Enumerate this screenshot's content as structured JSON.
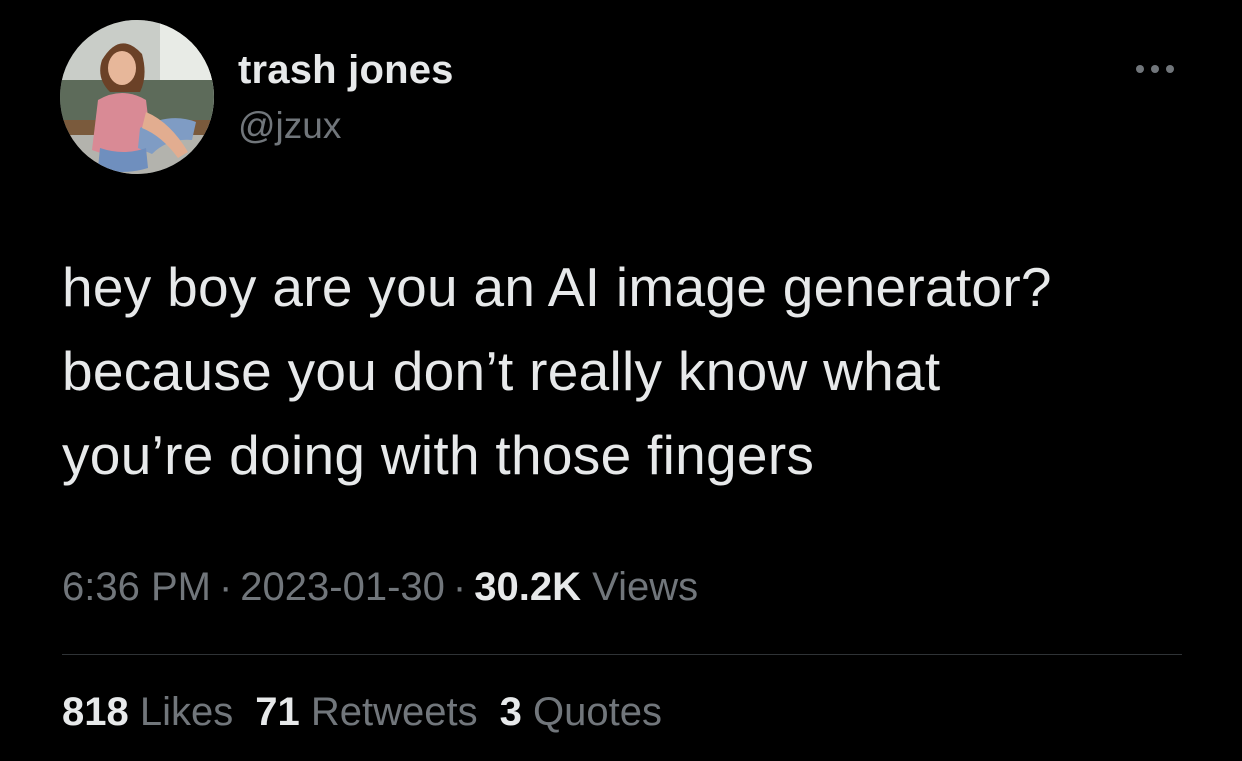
{
  "author": {
    "display_name": "trash jones",
    "handle": "@jzux",
    "avatar_icon": "profile-photo"
  },
  "more_icon": "more-horizontal-icon",
  "tweet": {
    "lines": [
      "hey boy are you an AI image generator?",
      "because you don’t really know what",
      "you’re doing with those fingers"
    ]
  },
  "meta": {
    "time": "6:36 PM",
    "separator": "·",
    "date": "2023-01-30",
    "views_count": "30.2K",
    "views_label": "Views"
  },
  "stats": {
    "likes_count": "818",
    "likes_label": "Likes",
    "retweets_count": "71",
    "retweets_label": "Retweets",
    "quotes_count": "3",
    "quotes_label": "Quotes"
  },
  "colors": {
    "background": "#000000",
    "primary_text": "#e7e9ea",
    "secondary_text": "#71767b",
    "divider": "#2f3336"
  }
}
